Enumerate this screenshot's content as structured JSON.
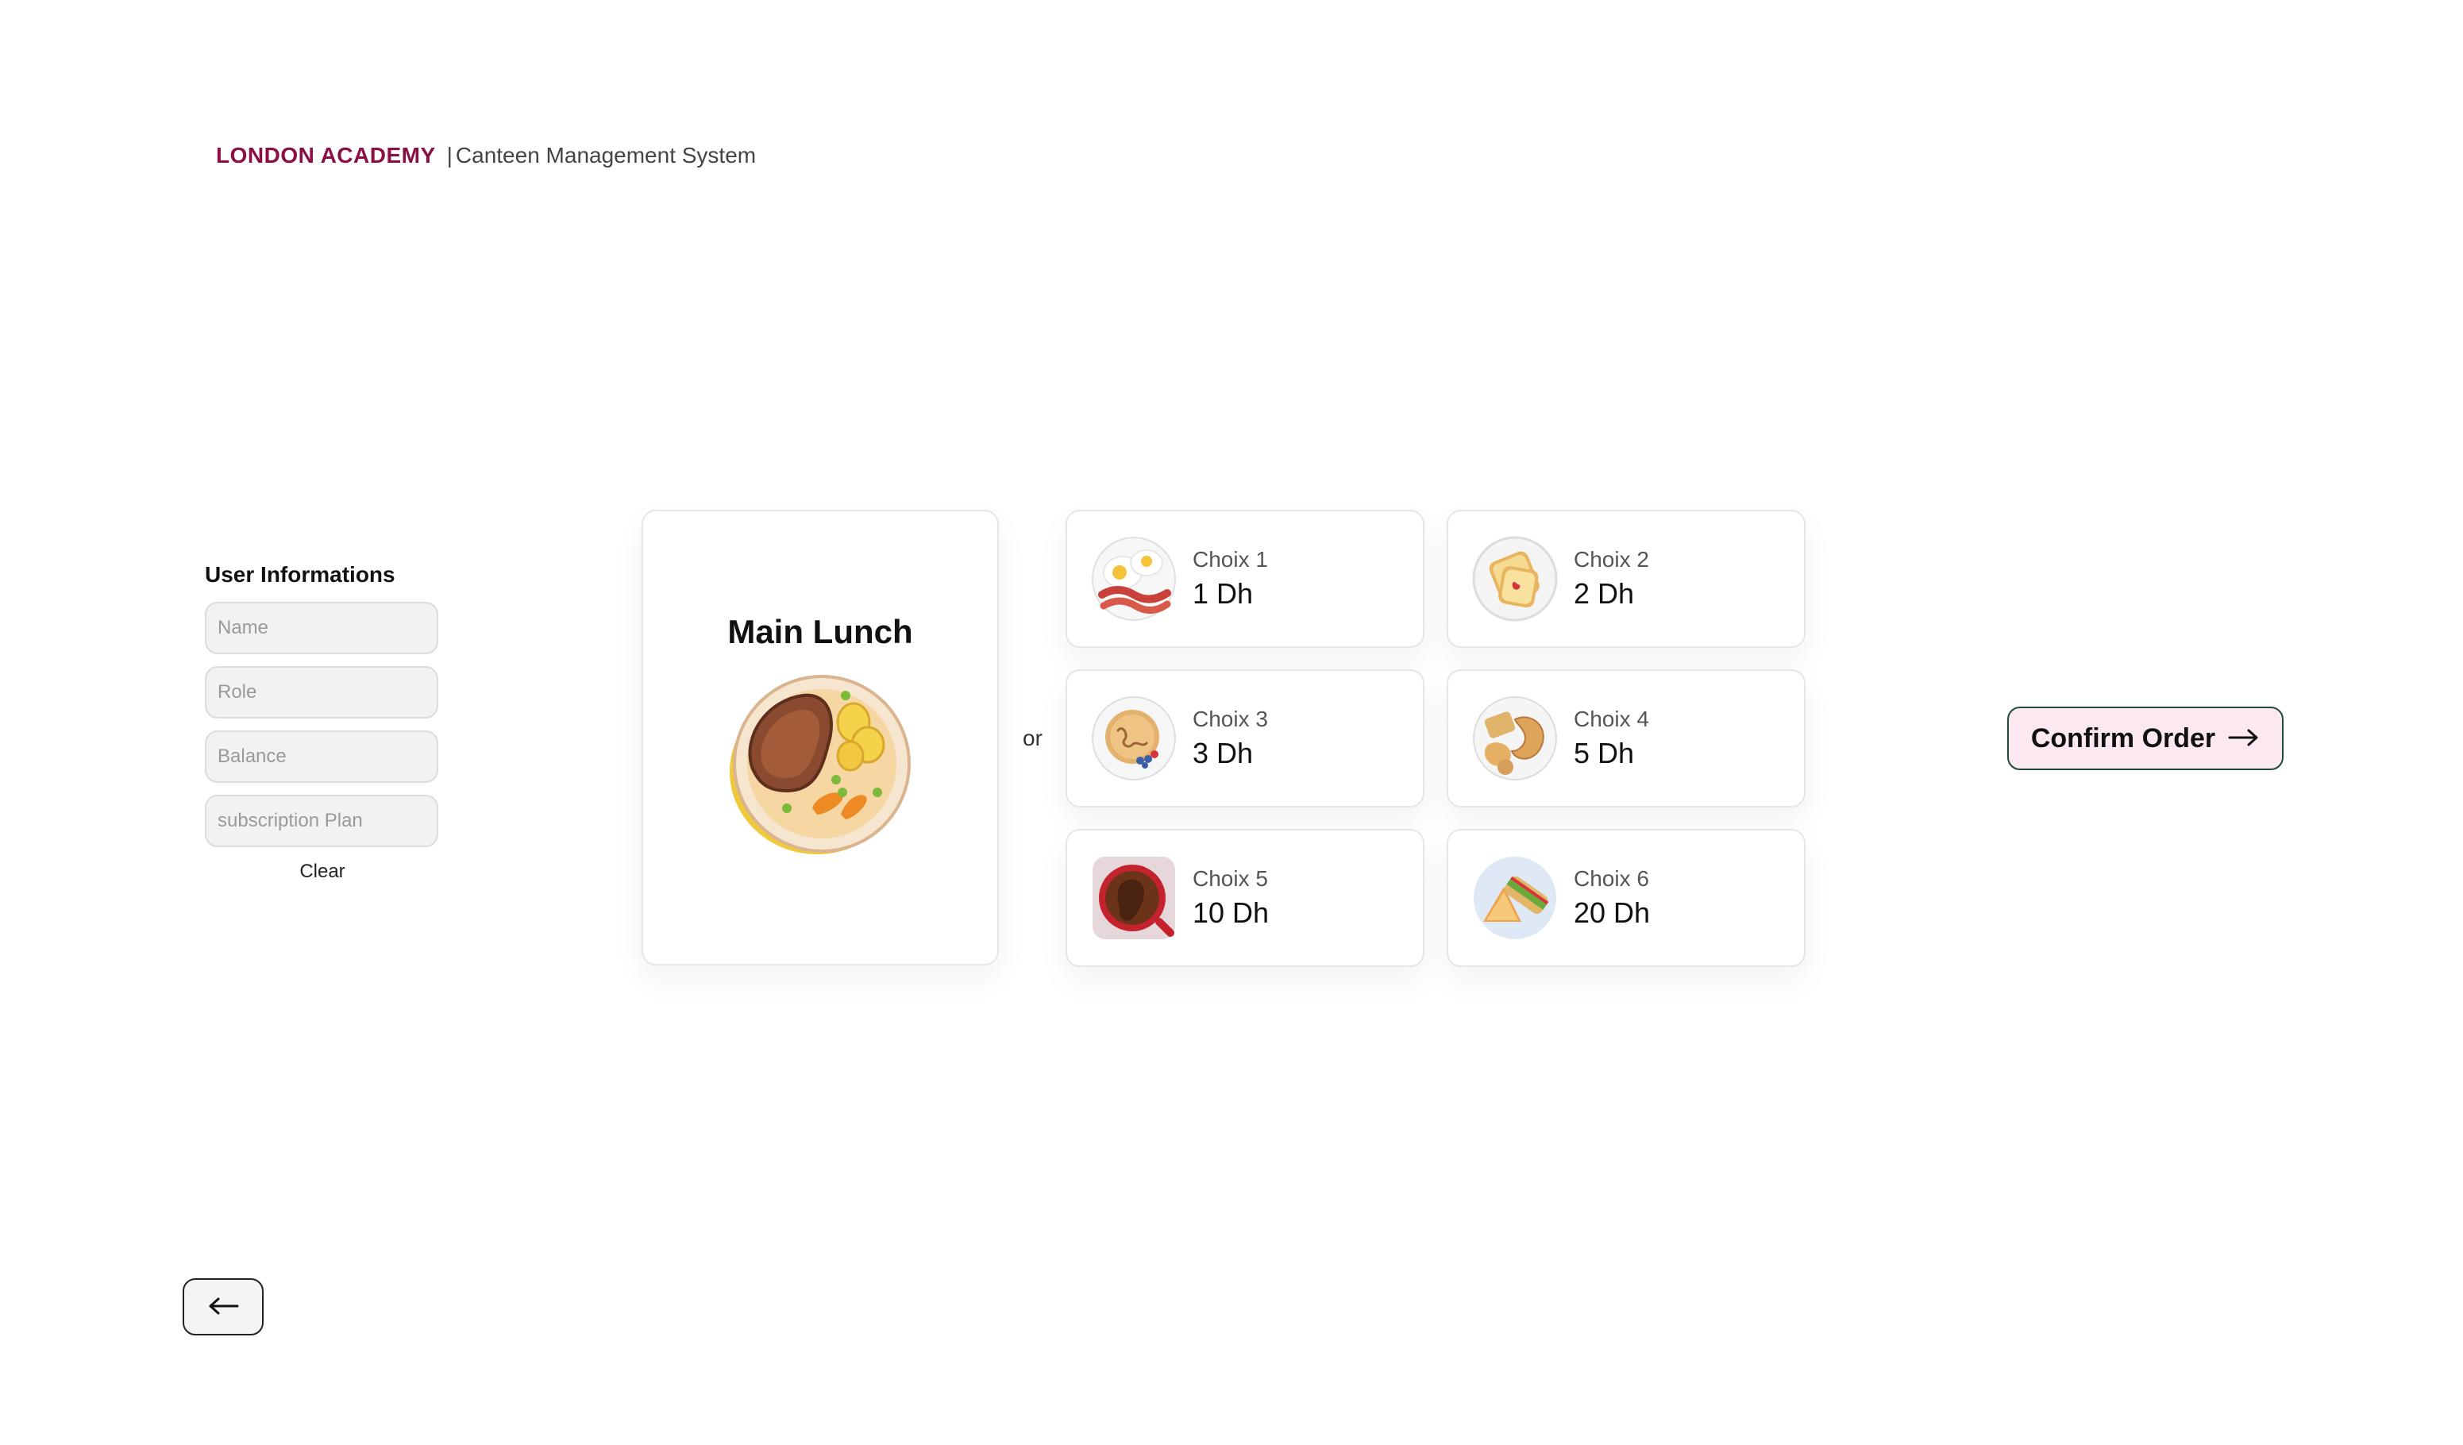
{
  "header": {
    "brand": "LONDON ACADEMY",
    "separator": "|",
    "subtitle": "Canteen Management System"
  },
  "user_panel": {
    "title": "User Informations",
    "fields": {
      "name_placeholder": "Name",
      "role_placeholder": "Role",
      "balance_placeholder": "Balance",
      "plan_placeholder": "subscription Plan"
    },
    "clear_label": "Clear"
  },
  "main_lunch": {
    "title": "Main Lunch",
    "icon": "steak-plate-icon"
  },
  "or_label": "or",
  "choices": [
    {
      "name": "Choix 1",
      "price": "1 Dh",
      "icon": "eggs-bacon-icon"
    },
    {
      "name": "Choix 2",
      "price": "2 Dh",
      "icon": "toast-jam-icon"
    },
    {
      "name": "Choix 3",
      "price": "3 Dh",
      "icon": "pancakes-icon"
    },
    {
      "name": "Choix 4",
      "price": "5 Dh",
      "icon": "pastries-icon"
    },
    {
      "name": "Choix 5",
      "price": "10 Dh",
      "icon": "coffee-cup-icon"
    },
    {
      "name": "Choix 6",
      "price": "20 Dh",
      "icon": "sandwich-icon"
    }
  ],
  "confirm": {
    "label": "Confirm Order",
    "icon": "arrow-right-icon"
  },
  "back": {
    "icon": "arrow-left-icon"
  },
  "colors": {
    "brand": "#8a0f44",
    "confirm_bg": "#fbe8f1",
    "confirm_border": "#1f4a3a"
  }
}
